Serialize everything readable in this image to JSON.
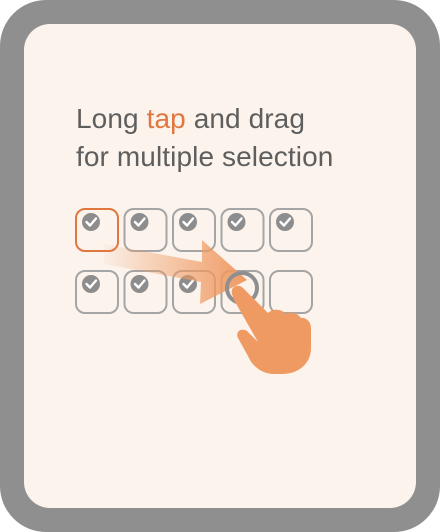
{
  "headline": {
    "part1": "Long ",
    "accent": "tap",
    "part2": " and drag",
    "line2": "for multiple selection"
  },
  "colors": {
    "accent": "#e0773f",
    "text": "#5e5e5e",
    "frame": "#8f8f8f",
    "background": "#fbf3ec",
    "checkbox_border": "#a5a5a5",
    "check_mark": "#8d8d8d",
    "hand": "#ef9a62"
  },
  "grid": {
    "rows": [
      [
        {
          "checked": true,
          "highlighted": true
        },
        {
          "checked": true,
          "highlighted": false
        },
        {
          "checked": true,
          "highlighted": false
        },
        {
          "checked": true,
          "highlighted": false
        },
        {
          "checked": true,
          "highlighted": false
        }
      ],
      [
        {
          "checked": true,
          "highlighted": false
        },
        {
          "checked": true,
          "highlighted": false
        },
        {
          "checked": true,
          "highlighted": false
        },
        {
          "checked": false,
          "highlighted": false
        },
        {
          "checked": false,
          "highlighted": false
        }
      ]
    ]
  },
  "icons": [
    "check-icon",
    "drag-arrow-icon",
    "hand-pointer-icon",
    "touch-ring-icon"
  ]
}
